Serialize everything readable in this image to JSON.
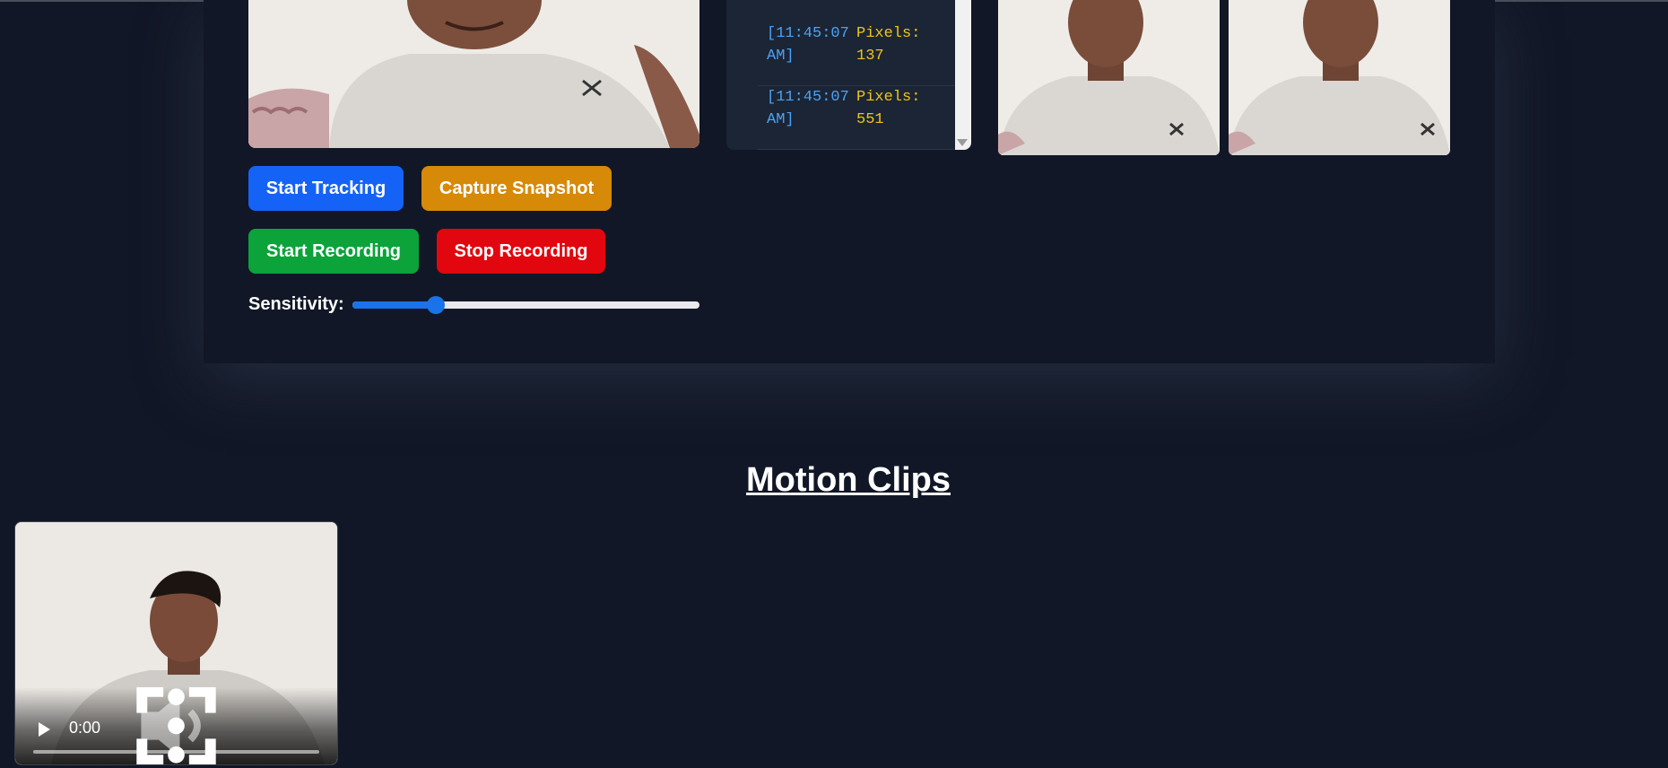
{
  "log": {
    "entries": [
      {
        "time": "[11:45:07\nAM]",
        "message": "Pixels:\n137"
      },
      {
        "time": "[11:45:07\nAM]",
        "message": "Pixels:\n551"
      }
    ]
  },
  "controls": {
    "start_tracking": "Start Tracking",
    "capture_snapshot": "Capture Snapshot",
    "start_recording": "Start Recording",
    "stop_recording": "Stop Recording",
    "sensitivity_label": "Sensitivity:",
    "sensitivity_fraction": 0.24
  },
  "clips": {
    "title": "Motion Clips",
    "items": [
      {
        "time": "0:00"
      }
    ]
  },
  "colors": {
    "background": "#111726",
    "blue": "#1563f6",
    "orange": "#d78a08",
    "green": "#0ba33a",
    "red": "#e2060e",
    "log_time": "#4ba2f5",
    "log_message": "#f0c419"
  },
  "icons": [
    "play-icon",
    "volume-icon",
    "fullscreen-icon",
    "more-options-icon"
  ]
}
